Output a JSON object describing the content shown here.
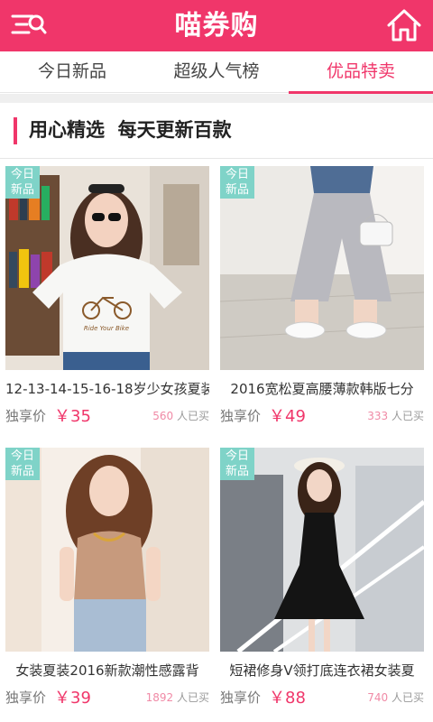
{
  "header": {
    "title": "喵券购"
  },
  "tabs": [
    "今日新品",
    "超级人气榜",
    "优品特卖"
  ],
  "section": {
    "title": "用心精选  每天更新百款"
  },
  "products": [
    {
      "badge_line1": "今日",
      "badge_line2": "新品",
      "name": "12-13-14-15-16-18岁少女孩夏装",
      "price_label": "独享价",
      "price": "￥35",
      "sold_count": "560",
      "sold_suffix": "人已买",
      "shirt_print": "Ride Your Bike"
    },
    {
      "badge_line1": "今日",
      "badge_line2": "新品",
      "name": "2016宽松夏高腰薄款韩版七分",
      "price_label": "独享价",
      "price": "￥49",
      "sold_count": "333",
      "sold_suffix": "人已买"
    },
    {
      "badge_line1": "今日",
      "badge_line2": "新品",
      "name": "女装夏装2016新款潮性感露背",
      "price_label": "独享价",
      "price": "￥39",
      "sold_count": "1892",
      "sold_suffix": "人已买"
    },
    {
      "badge_line1": "今日",
      "badge_line2": "新品",
      "name": "短裙修身V领打底连衣裙女装夏",
      "price_label": "独享价",
      "price": "￥88",
      "sold_count": "740",
      "sold_suffix": "人已买"
    }
  ],
  "colors": {
    "brand": "#f0366a",
    "badge": "#7fd3c8"
  }
}
